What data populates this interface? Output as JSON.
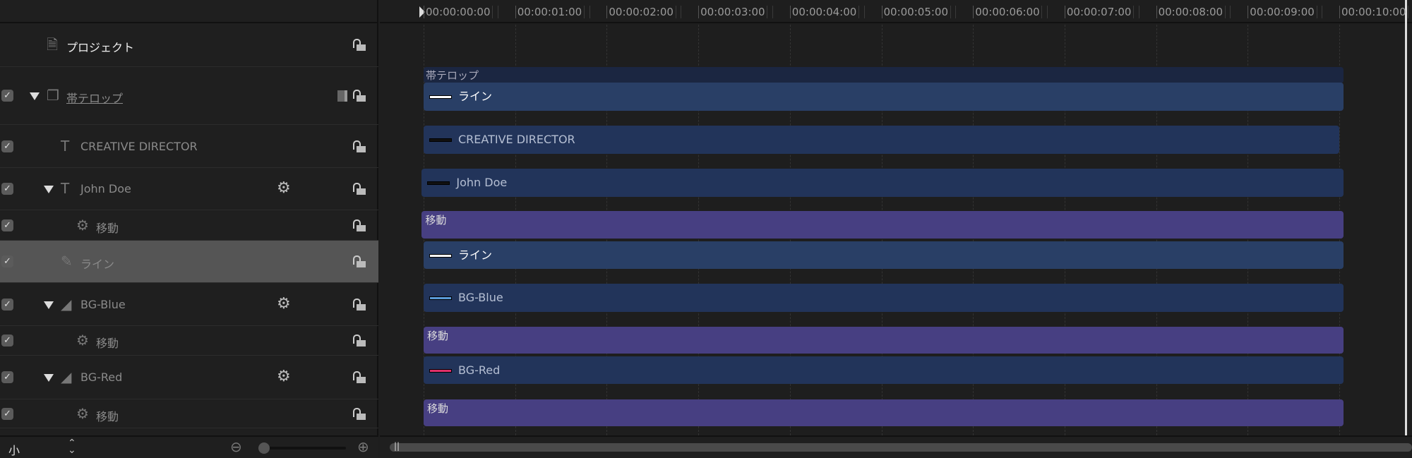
{
  "layers": [
    {
      "label": "プロジェクト",
      "icon": "document-icon",
      "checkbox": false,
      "disclosure": false,
      "gear": false,
      "indent": 0,
      "style": "white"
    },
    {
      "label": "帯テロップ",
      "icon": "group-icon",
      "checkbox": true,
      "disclosure": true,
      "gear": false,
      "indent": 0,
      "style": "ul",
      "extra": "group-mode-icon"
    },
    {
      "label": "CREATIVE DIRECTOR",
      "icon": "text-icon",
      "checkbox": true,
      "disclosure": false,
      "gear": false,
      "indent": 1
    },
    {
      "label": "John Doe",
      "icon": "text-icon",
      "checkbox": true,
      "disclosure": true,
      "gear": true,
      "indent": 1
    },
    {
      "label": "移動",
      "icon": "behavior-icon",
      "checkbox": true,
      "disclosure": false,
      "gear": false,
      "indent": 2
    },
    {
      "label": "ライン",
      "icon": "paint-stroke-icon",
      "checkbox": true,
      "disclosure": false,
      "gear": false,
      "indent": 1,
      "selected": true
    },
    {
      "label": "BG-Blue",
      "icon": "shape-icon",
      "checkbox": true,
      "disclosure": true,
      "gear": true,
      "indent": 1
    },
    {
      "label": "移動",
      "icon": "behavior-icon",
      "checkbox": true,
      "disclosure": false,
      "gear": false,
      "indent": 2
    },
    {
      "label": "BG-Red",
      "icon": "shape-icon",
      "checkbox": true,
      "disclosure": true,
      "gear": true,
      "indent": 1
    },
    {
      "label": "移動",
      "icon": "behavior-icon",
      "checkbox": true,
      "disclosure": false,
      "gear": false,
      "indent": 2
    }
  ],
  "footer": {
    "size_label": "小"
  },
  "ruler": {
    "ticks": [
      "00:00:00:00",
      "00:00:01:00",
      "00:00:02:00",
      "00:00:03:00",
      "00:00:04:00",
      "00:00:05:00",
      "00:00:06:00",
      "00:00:07:00",
      "00:00:08:00",
      "00:00:09:00",
      "00:00:10:00"
    ]
  },
  "clips": [
    {
      "label": "帯テロップ",
      "kind": "group",
      "start": 0,
      "end": 10.05
    },
    {
      "label": "ライン",
      "kind": "blue2",
      "swatch": "#ffffff",
      "start": 0,
      "end": 10.05
    },
    {
      "label": "CREATIVE DIRECTOR",
      "kind": "blue",
      "swatch": "#111111",
      "start": 0,
      "end": 10.0
    },
    {
      "label": "John Doe",
      "kind": "blue",
      "swatch": "#111111",
      "start": -0.02,
      "end": 10.05
    },
    {
      "label": "移動",
      "kind": "purple",
      "start": -0.02,
      "end": 10.05
    },
    {
      "label": "ライン",
      "kind": "blue2",
      "swatch": "#ffffff",
      "start": 0,
      "end": 10.05
    },
    {
      "label": "BG-Blue",
      "kind": "blue",
      "swatch": "#5a9bd8",
      "start": 0,
      "end": 10.05
    },
    {
      "label": "移動",
      "kind": "purple",
      "start": 0,
      "end": 10.05
    },
    {
      "label": "BG-Red",
      "kind": "blue",
      "swatch": "#e0306a",
      "start": 0,
      "end": 10.05
    },
    {
      "label": "移動",
      "kind": "purple",
      "start": 0,
      "end": 10.05
    }
  ],
  "colors": {
    "clip_blue": "#22345a",
    "clip_purple": "#473f82",
    "selected_row": "#555555"
  }
}
